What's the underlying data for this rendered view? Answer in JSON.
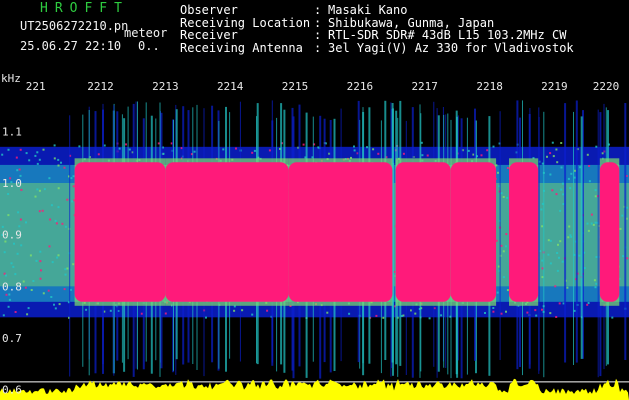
{
  "header": {
    "app_title": "HROFFT",
    "filename": "UT2506272210.pn",
    "filename_suffix": "meteor",
    "datetime": "25.06.27 22:10",
    "datetime_suffix": "0..",
    "info": [
      {
        "key": "Observer",
        "sep": ":",
        "value": "Masaki Kano"
      },
      {
        "key": "Receiving Location",
        "sep": ":",
        "value": "Shibukawa, Gunma, Japan"
      },
      {
        "key": "Receiver",
        "sep": ":",
        "value": "RTL-SDR SDR# 43dB L15 103.2MHz CW"
      },
      {
        "key": "Receiving Antenna",
        "sep": ":",
        "value": "3el Yagi(V) Az 330 for Vladivostok"
      }
    ]
  },
  "chart_data": {
    "type": "heatmap",
    "ylabel": "kHz",
    "y_ticks": [
      "1.1",
      "1.0",
      "0.9",
      "0.8",
      "0.7",
      "0.6"
    ],
    "y_tick_values": [
      1.1,
      1.0,
      0.9,
      0.8,
      0.7,
      0.6
    ],
    "ylim": [
      0.58,
      1.18
    ],
    "x_ticks": [
      "221",
      "2212",
      "2213",
      "2214",
      "2215",
      "2216",
      "2217",
      "2218",
      "2219",
      "2220"
    ],
    "x_tick_minutes": [
      1,
      2,
      3,
      4,
      5,
      6,
      7,
      8,
      9,
      10
    ],
    "xlim_minutes": [
      0.45,
      10.15
    ],
    "strong_signal_segments_minutes": [
      [
        1.6,
        3.0
      ],
      [
        3.0,
        4.9
      ],
      [
        4.9,
        6.5
      ],
      [
        6.55,
        7.4
      ],
      [
        7.4,
        8.1
      ],
      [
        8.3,
        8.75
      ],
      [
        9.7,
        10.0
      ]
    ],
    "colors": {
      "background": "#000000",
      "noise": "#0b1fd0",
      "mid": "#22c7c7",
      "high": "#7fe06a",
      "saturated": "#ff1a7a",
      "power_trace": "#ffff00",
      "baseline": "#ffffff"
    }
  }
}
